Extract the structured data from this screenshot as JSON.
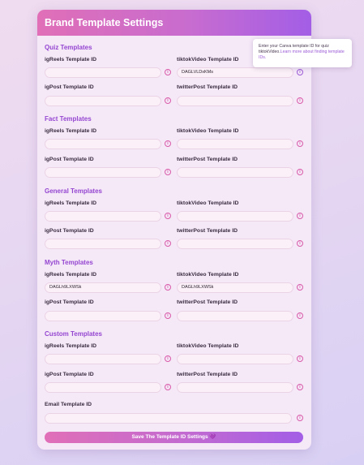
{
  "header": {
    "title": "Brand Template Settings"
  },
  "sections": [
    {
      "title": "Quiz Templates",
      "fields": [
        {
          "label": "igReels Template ID",
          "value": ""
        },
        {
          "label": "tiktokVideo Template ID",
          "value": "DAGLVLDxKMs"
        },
        {
          "label": "igPost Template ID",
          "value": ""
        },
        {
          "label": "twitterPost Template ID",
          "value": ""
        }
      ]
    },
    {
      "title": "Fact Templates",
      "fields": [
        {
          "label": "igReels Template ID",
          "value": ""
        },
        {
          "label": "tiktokVideo Template ID",
          "value": ""
        },
        {
          "label": "igPost Template ID",
          "value": ""
        },
        {
          "label": "twitterPost Template ID",
          "value": ""
        }
      ]
    },
    {
      "title": "General Templates",
      "fields": [
        {
          "label": "igReels Template ID",
          "value": ""
        },
        {
          "label": "tiktokVideo Template ID",
          "value": ""
        },
        {
          "label": "igPost Template ID",
          "value": ""
        },
        {
          "label": "twitterPost Template ID",
          "value": ""
        }
      ]
    },
    {
      "title": "Myth Templates",
      "fields": [
        {
          "label": "igReels Template ID",
          "value": "DAGLh9LXWSk"
        },
        {
          "label": "tiktokVideo Template ID",
          "value": "DAGLh9LXWSk"
        },
        {
          "label": "igPost Template ID",
          "value": ""
        },
        {
          "label": "twitterPost Template ID",
          "value": ""
        }
      ]
    },
    {
      "title": "Custom Templates",
      "fields": [
        {
          "label": "igReels Template ID",
          "value": ""
        },
        {
          "label": "tiktokVideo Template ID",
          "value": ""
        },
        {
          "label": "igPost Template ID",
          "value": ""
        },
        {
          "label": "twitterPost Template ID",
          "value": ""
        }
      ]
    }
  ],
  "email": {
    "label": "Email Template ID",
    "value": ""
  },
  "save_button": {
    "label": "Save The Template ID Settings 💜"
  },
  "tooltip": {
    "text": "Enter your Canva template ID for quiz tiktokVideo.",
    "link": "Learn more about finding template IDs."
  },
  "info_icon": {
    "glyph": "i",
    "name": "info-icon"
  },
  "colors": {
    "accent_pink": "#e06fb7",
    "accent_purple": "#a35ee6",
    "section_title": "#9546d0"
  }
}
